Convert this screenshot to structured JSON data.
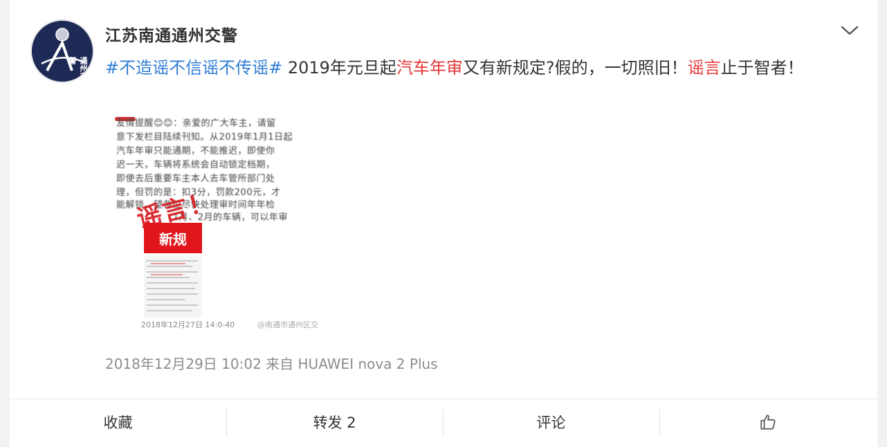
{
  "post": {
    "author": "江苏南通通州交警",
    "avatar_text": "通州交警",
    "hashtag": "#不造谣不信谣不传谣#",
    "text_part1": " 2019年元旦起",
    "keyword1": "汽车年审",
    "text_part2": "又有新规定?假的，一切照旧！",
    "keyword2": "谣言",
    "text_part3": "止于智者！",
    "timestamp": "2018年12月29日 10:02",
    "source": "来自 HUAWEI nova 2 Plus"
  },
  "image": {
    "notice_lines": [
      "友情提醒😊😊：亲爱的广大车主，请留",
      "意下发栏目陆续刊知。从2019年1月1日起",
      "汽车年审只能通期，不能推迟，即使你",
      "迟一天，车辆将系统会自动锁定档期，",
      "即使去后重要车主本人去车管所部门处",
      "理，但罚的是：扣3分，罚款200元，才",
      "能解锁。望各位尽快处理审时间年年检",
      "1月、2月的车辆，可以年审"
    ],
    "stamp": "谣言！",
    "badge": "新规",
    "caption": "2018年12月27日 14:0-40",
    "watermark": "@南通市通州区交警"
  },
  "actions": {
    "favorite": "收藏",
    "repost": "转发 2",
    "comment": "评论"
  },
  "icons": {
    "menu": "chevron-down-icon",
    "like": "thumbs-up-icon"
  },
  "colors": {
    "hashtag": "#2f7dd6",
    "highlight": "#e6393b",
    "meta": "#8c8c8c",
    "badge": "#e0161c"
  }
}
